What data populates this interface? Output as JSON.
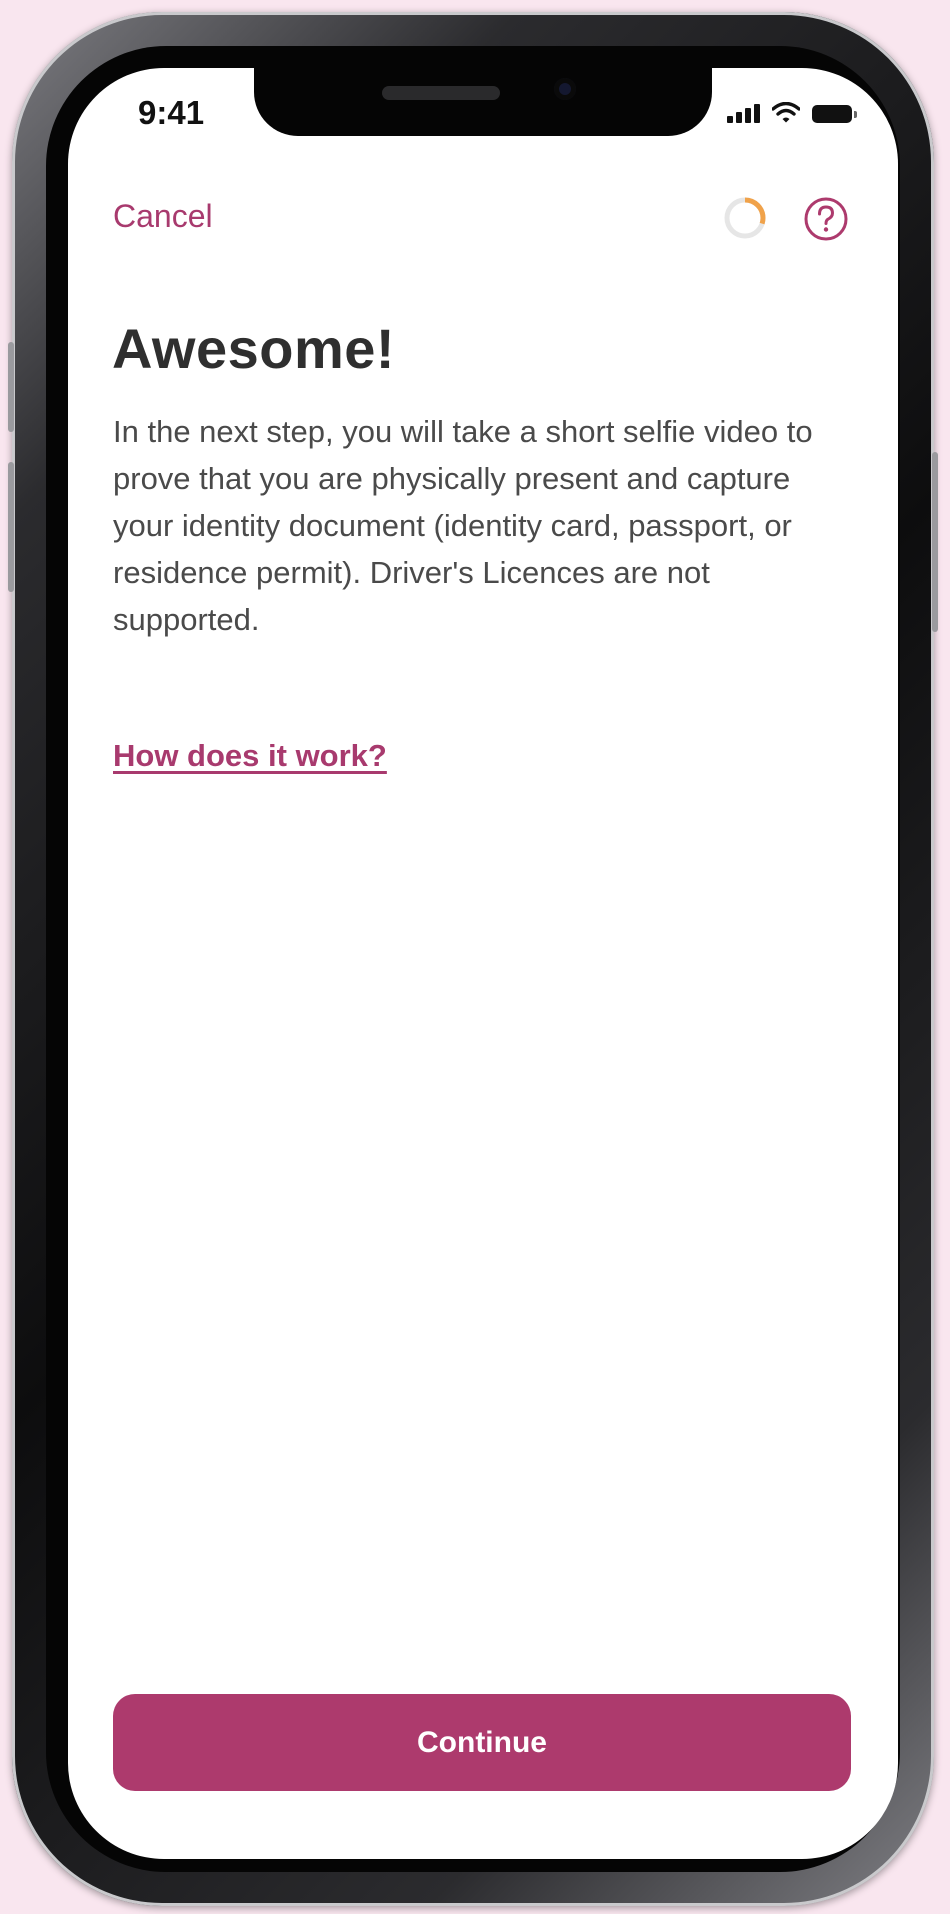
{
  "status_bar": {
    "time": "9:41",
    "icons": [
      "cellular-signal-icon",
      "wifi-icon",
      "battery-icon"
    ]
  },
  "header": {
    "cancel_label": "Cancel",
    "progress_icon": "progress-ring-icon",
    "progress_fraction": 0.3,
    "help_icon": "question-mark-circle-icon"
  },
  "content": {
    "title": "Awesome!",
    "body": "In the next step, you will take a short selfie video to prove that you are physically present and capture your identity document (identity card, passport, or residence permit). Driver's Licences are not supported.",
    "link_label": "How does it work?"
  },
  "footer": {
    "continue_label": "Continue"
  },
  "colors": {
    "accent": "#ad3a6d",
    "progress": "#f0a24a",
    "progress_track": "#e6e6e6",
    "background": "#f9e6ef",
    "title": "#2f2f2f",
    "body": "#4a4a4a"
  }
}
